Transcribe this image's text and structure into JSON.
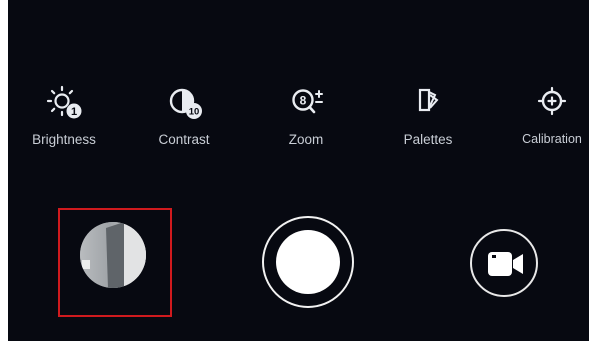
{
  "toolbar": {
    "items": [
      {
        "label": "Brightness",
        "icon": "brightness-icon",
        "badge": "1"
      },
      {
        "label": "Contrast",
        "icon": "contrast-icon",
        "badge": "10"
      },
      {
        "label": "Zoom",
        "icon": "zoom-icon",
        "badge": "8"
      },
      {
        "label": "Palettes",
        "icon": "palettes-icon"
      },
      {
        "label": "Calibration",
        "icon": "calibration-icon"
      }
    ]
  },
  "capture": {
    "gallery_icon": "gallery-thumbnail",
    "shutter_icon": "shutter-icon",
    "video_icon": "video-camera-icon"
  },
  "colors": {
    "background": "#070911",
    "highlight": "#d01a1e",
    "icon": "#e9ecf1",
    "label": "#c9ced6"
  }
}
